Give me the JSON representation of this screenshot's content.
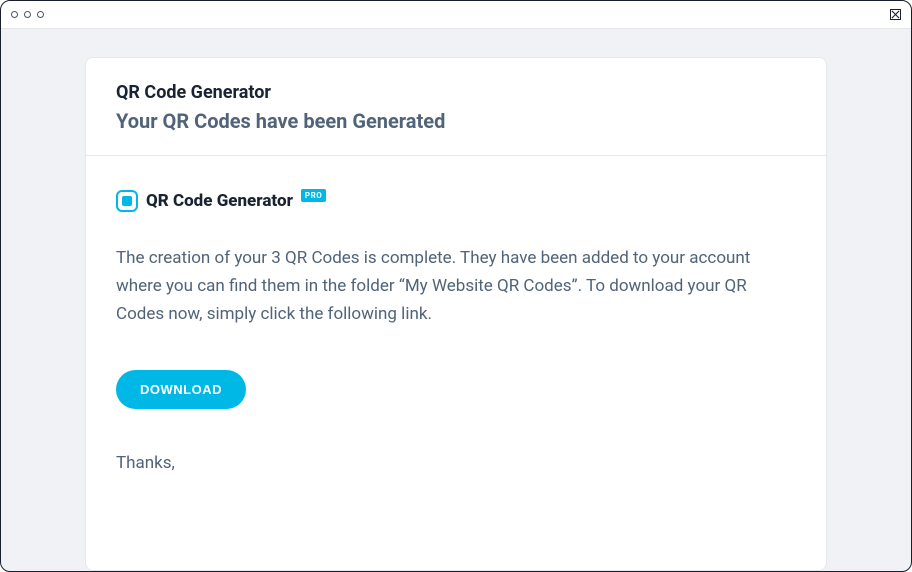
{
  "header": {
    "sender": "QR Code Generator",
    "subject": "Your QR Codes have been Generated"
  },
  "logo": {
    "text": "QR Code Generator",
    "badge": "PRO"
  },
  "body": {
    "text": "The creation of your 3 QR Codes is complete. They have been added to your account where you can find them in the folder “My Website QR Codes”. To download your QR Codes now, simply click the following link."
  },
  "button": {
    "download": "DOWNLOAD"
  },
  "signoff": "Thanks,",
  "colors": {
    "accent": "#00b8e6"
  }
}
